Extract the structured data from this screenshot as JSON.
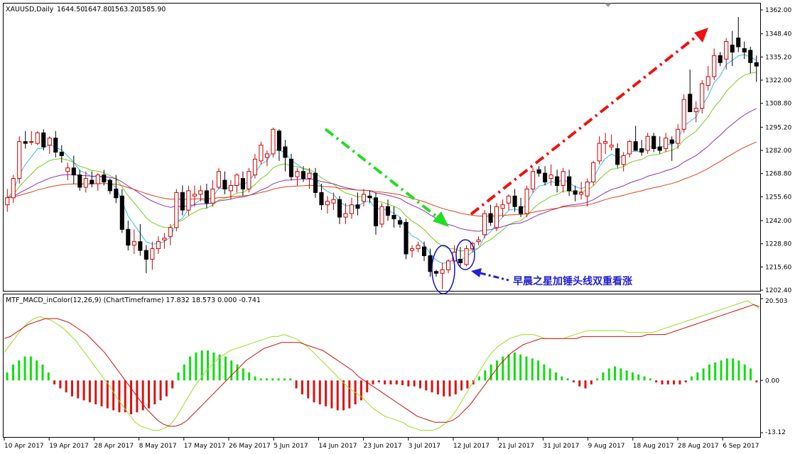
{
  "chart_data": [
    {
      "type": "candlestick",
      "title": "XAUUSD,Daily",
      "ohlc_summary": [
        "1644.50",
        "1647.80",
        "1563.20",
        "1585.90"
      ],
      "ylim": [
        1202.4,
        1362.0
      ],
      "y_ticks": [
        "1362.00",
        "1348.40",
        "1335.20",
        "1322.00",
        "1308.80",
        "1295.20",
        "1282.00",
        "1268.80",
        "1255.60",
        "1242.00",
        "1228.80",
        "1215.60",
        "1202.40"
      ],
      "x_ticks": [
        "10 Apr 2017",
        "19 Apr 2017",
        "28 Apr 2017",
        "8 May 2017",
        "17 May 2017",
        "26 May 2017",
        "5 Jun 2017",
        "14 Jun 2017",
        "23 Jun 2017",
        "3 Jul 2017",
        "12 Jul 2017",
        "21 Jul 2017",
        "31 Jul 2017",
        "9 Aug 2017",
        "18 Aug 2017",
        "28 Aug 2017",
        "6 Sep 2017"
      ],
      "colors": {
        "bull": "#cc0000",
        "bear": "#000000",
        "ma_fast": "#33bbee",
        "ma_mid": "#77cc22",
        "ma_slow": "#8833bb",
        "ma_long": "#dd4411"
      },
      "candles": [
        [
          1251,
          1260,
          1247,
          1255
        ],
        [
          1255,
          1268,
          1252,
          1266
        ],
        [
          1266,
          1290,
          1263,
          1287
        ],
        [
          1287,
          1293,
          1283,
          1286
        ],
        [
          1287,
          1293,
          1285,
          1287
        ],
        [
          1286,
          1293,
          1285,
          1292
        ],
        [
          1292,
          1294,
          1282,
          1284
        ],
        [
          1285,
          1290,
          1280,
          1289
        ],
        [
          1289,
          1293,
          1278,
          1281
        ],
        [
          1281,
          1285,
          1275,
          1279
        ],
        [
          1270,
          1275,
          1265,
          1272
        ],
        [
          1272,
          1279,
          1263,
          1268
        ],
        [
          1268,
          1271,
          1259,
          1261
        ],
        [
          1261,
          1270,
          1258,
          1266
        ],
        [
          1265,
          1270,
          1261,
          1263
        ],
        [
          1263,
          1269,
          1259,
          1268
        ],
        [
          1268,
          1271,
          1262,
          1264
        ],
        [
          1265,
          1266,
          1257,
          1259
        ],
        [
          1260,
          1268,
          1252,
          1255
        ],
        [
          1256,
          1260,
          1235,
          1237
        ],
        [
          1237,
          1242,
          1225,
          1228
        ],
        [
          1228,
          1237,
          1223,
          1230
        ],
        [
          1230,
          1240,
          1222,
          1225
        ],
        [
          1225,
          1228,
          1212,
          1220
        ],
        [
          1220,
          1230,
          1214,
          1226
        ],
        [
          1226,
          1233,
          1223,
          1230
        ],
        [
          1231,
          1235,
          1226,
          1232
        ],
        [
          1233,
          1240,
          1228,
          1238
        ],
        [
          1238,
          1260,
          1236,
          1258
        ],
        [
          1258,
          1262,
          1245,
          1248
        ],
        [
          1248,
          1262,
          1245,
          1259
        ],
        [
          1256,
          1262,
          1250,
          1257
        ],
        [
          1257,
          1262,
          1253,
          1259
        ],
        [
          1259,
          1263,
          1249,
          1252
        ],
        [
          1252,
          1265,
          1250,
          1260
        ],
        [
          1261,
          1272,
          1260,
          1270
        ],
        [
          1265,
          1270,
          1257,
          1260
        ],
        [
          1259,
          1265,
          1254,
          1262
        ],
        [
          1262,
          1269,
          1258,
          1268
        ],
        [
          1266,
          1270,
          1256,
          1260
        ],
        [
          1260,
          1272,
          1258,
          1270
        ],
        [
          1268,
          1280,
          1266,
          1277
        ],
        [
          1276,
          1287,
          1274,
          1285
        ],
        [
          1278,
          1282,
          1273,
          1280
        ],
        [
          1280,
          1295,
          1278,
          1294
        ],
        [
          1293,
          1294,
          1276,
          1282
        ],
        [
          1284,
          1288,
          1270,
          1278
        ],
        [
          1277,
          1280,
          1265,
          1267
        ],
        [
          1267,
          1272,
          1262,
          1270
        ],
        [
          1270,
          1273,
          1264,
          1266
        ],
        [
          1266,
          1272,
          1260,
          1269
        ],
        [
          1269,
          1272,
          1255,
          1258
        ],
        [
          1258,
          1263,
          1248,
          1251
        ],
        [
          1251,
          1256,
          1246,
          1253
        ],
        [
          1252,
          1258,
          1248,
          1254
        ],
        [
          1254,
          1256,
          1240,
          1244
        ],
        [
          1244,
          1252,
          1240,
          1246
        ],
        [
          1246,
          1255,
          1243,
          1251
        ],
        [
          1251,
          1258,
          1245,
          1249
        ],
        [
          1253,
          1260,
          1250,
          1257
        ],
        [
          1256,
          1259,
          1252,
          1255
        ],
        [
          1255,
          1258,
          1234,
          1239
        ],
        [
          1240,
          1252,
          1238,
          1250
        ],
        [
          1250,
          1254,
          1242,
          1245
        ],
        [
          1245,
          1250,
          1238,
          1243
        ],
        [
          1242,
          1244,
          1238,
          1240
        ],
        [
          1241,
          1243,
          1220,
          1223
        ],
        [
          1225,
          1228,
          1221,
          1226
        ],
        [
          1226,
          1230,
          1224,
          1228
        ],
        [
          1227,
          1230,
          1219,
          1222
        ],
        [
          1222,
          1226,
          1210,
          1213
        ],
        [
          1213,
          1214,
          1210,
          1212
        ],
        [
          1212,
          1218,
          1203,
          1214
        ],
        [
          1214,
          1220,
          1212,
          1219
        ],
        [
          1219,
          1228,
          1216,
          1224
        ],
        [
          1220,
          1227,
          1216,
          1218
        ],
        [
          1217,
          1228,
          1216,
          1226
        ],
        [
          1226,
          1230,
          1224,
          1229
        ],
        [
          1230,
          1233,
          1228,
          1231
        ],
        [
          1234,
          1248,
          1232,
          1246
        ],
        [
          1246,
          1251,
          1239,
          1241
        ],
        [
          1238,
          1252,
          1236,
          1250
        ],
        [
          1249,
          1254,
          1244,
          1251
        ],
        [
          1252,
          1257,
          1248,
          1256
        ],
        [
          1256,
          1260,
          1247,
          1250
        ],
        [
          1250,
          1255,
          1244,
          1246
        ],
        [
          1246,
          1262,
          1244,
          1260
        ],
        [
          1260,
          1272,
          1258,
          1270
        ],
        [
          1271,
          1273,
          1267,
          1269
        ],
        [
          1269,
          1273,
          1262,
          1264
        ],
        [
          1266,
          1274,
          1262,
          1268
        ],
        [
          1267,
          1271,
          1258,
          1262
        ],
        [
          1262,
          1272,
          1258,
          1270
        ],
        [
          1267,
          1271,
          1256,
          1259
        ],
        [
          1259,
          1262,
          1253,
          1257
        ],
        [
          1257,
          1264,
          1254,
          1258
        ],
        [
          1256,
          1266,
          1250,
          1264
        ],
        [
          1264,
          1276,
          1262,
          1275
        ],
        [
          1276,
          1290,
          1274,
          1286
        ],
        [
          1286,
          1292,
          1280,
          1287
        ],
        [
          1284,
          1291,
          1282,
          1285
        ],
        [
          1283,
          1286,
          1272,
          1274
        ],
        [
          1274,
          1281,
          1270,
          1279
        ],
        [
          1280,
          1288,
          1278,
          1287
        ],
        [
          1287,
          1296,
          1283,
          1282
        ],
        [
          1283,
          1288,
          1279,
          1281
        ],
        [
          1282,
          1292,
          1280,
          1290
        ],
        [
          1290,
          1292,
          1281,
          1283
        ],
        [
          1284,
          1290,
          1280,
          1282
        ],
        [
          1283,
          1292,
          1281,
          1289
        ],
        [
          1288,
          1290,
          1276,
          1286
        ],
        [
          1286,
          1297,
          1283,
          1294
        ],
        [
          1294,
          1314,
          1292,
          1311
        ],
        [
          1314,
          1328,
          1308,
          1304
        ],
        [
          1304,
          1310,
          1298,
          1306
        ],
        [
          1306,
          1322,
          1303,
          1320
        ],
        [
          1319,
          1330,
          1316,
          1324
        ],
        [
          1324,
          1340,
          1322,
          1336
        ],
        [
          1336,
          1338,
          1330,
          1332
        ],
        [
          1334,
          1346,
          1328,
          1344
        ],
        [
          1342,
          1350,
          1330,
          1338
        ],
        [
          1346,
          1358,
          1338,
          1341
        ],
        [
          1340,
          1344,
          1334,
          1338
        ],
        [
          1339,
          1341,
          1326,
          1332
        ],
        [
          1332,
          1336,
          1321,
          1330
        ]
      ],
      "annotation": "早晨之星加锤头线双重看涨"
    },
    {
      "type": "histogram",
      "title": "MTF_MACD_inColor(12,26,9) (ChartTimeframe) 17.832 18.573 0.000 -0.741",
      "ylim": [
        -13.12,
        20.503
      ],
      "y_ticks": [
        "20.503",
        "0.00",
        "-13.12"
      ],
      "colors": {
        "positive": "#11dd11",
        "negative": "#dd1111",
        "macd_line": "#99dd22",
        "signal_line": "#cc1111"
      },
      "histogram": [
        2,
        4,
        5,
        6,
        6,
        5,
        4,
        2,
        -1,
        -2,
        -3,
        -4,
        -4.5,
        -5,
        -5.5,
        -6,
        -6.5,
        -7,
        -7.5,
        -8,
        -8,
        -8.5,
        -8,
        -7.5,
        -7,
        -6,
        -5,
        -4,
        -2,
        2,
        4,
        6,
        7,
        7.5,
        7.5,
        7,
        6.5,
        6,
        5,
        4,
        3,
        2,
        1,
        0.5,
        0.5,
        0.5,
        0.5,
        0.5,
        0.5,
        -2,
        -3.5,
        -4.5,
        -5.5,
        -6,
        -6.5,
        -7,
        -7.5,
        -7.5,
        -7,
        -6,
        -5,
        -3,
        -1,
        -0.5,
        -1,
        -1,
        -1,
        -1.2,
        -1.5,
        -1.5,
        -2,
        -2.5,
        -3,
        -3.5,
        -4,
        -4,
        -3.5,
        -2.5,
        -2,
        -1,
        1,
        2.5,
        4,
        5,
        6,
        6.5,
        7,
        6.5,
        6,
        5.5,
        5,
        4,
        3,
        2,
        1,
        0.5,
        -0.5,
        -1.5,
        -2,
        -1,
        0.5,
        2,
        3,
        3.5,
        3,
        2.5,
        2,
        1.5,
        1,
        0.5,
        -0.5,
        -1,
        -1,
        -1,
        -1,
        -0.5,
        1,
        2,
        3,
        4,
        4.5,
        5,
        5.5,
        5.5,
        5,
        4,
        3,
        -0.5
      ],
      "macd_line": [
        7,
        9,
        11,
        13,
        14.5,
        15.5,
        16,
        15.5,
        15,
        14,
        13,
        11.5,
        10,
        8,
        6,
        4,
        2,
        0,
        -2,
        -4.5,
        -6.5,
        -8.5,
        -10.5,
        -11.5,
        -12,
        -12.5,
        -12.5,
        -12,
        -11,
        -9,
        -6.5,
        -4,
        -1.5,
        0.5,
        2.5,
        4,
        5.5,
        6.5,
        7.5,
        8,
        8.5,
        9,
        9.5,
        10,
        10.5,
        11,
        11,
        11.5,
        11,
        10.5,
        9.5,
        8.5,
        7,
        5.5,
        4,
        2.5,
        1,
        -0.5,
        -2,
        -3,
        -4,
        -5.5,
        -7,
        -8,
        -9,
        -9.5,
        -10,
        -10.5,
        -11.5,
        -12,
        -12.5,
        -12.5,
        -12.5,
        -12,
        -11,
        -9.5,
        -7.5,
        -5,
        -2.5,
        0,
        2.5,
        5,
        7,
        8.5,
        9.5,
        10.5,
        11,
        11.5,
        11.5,
        11.5,
        11,
        10.5,
        10.5,
        10.5,
        10.5,
        11,
        11.5,
        12,
        12.5,
        12.5,
        12.5,
        12.5,
        12.5,
        12.5,
        12.5,
        12,
        12,
        12,
        12,
        12,
        12.5,
        13,
        13.5,
        14,
        14.5,
        15,
        15.5,
        16,
        16.5,
        17,
        17.5,
        18,
        18.5,
        19,
        19.5,
        20,
        19,
        18
      ],
      "signal_line": [
        10.5,
        11,
        12,
        13,
        14,
        14.5,
        15,
        15.5,
        15.5,
        15.5,
        15,
        14.5,
        13.5,
        12.5,
        11.5,
        10,
        8.5,
        7,
        5,
        3,
        1,
        -1,
        -3,
        -5,
        -7,
        -8.5,
        -10,
        -11,
        -11.5,
        -11.5,
        -11,
        -10,
        -8.5,
        -7,
        -5.5,
        -4,
        -2.5,
        -1,
        0.5,
        2,
        3.5,
        5,
        6,
        7,
        8,
        8.5,
        9,
        9.5,
        9.5,
        9.5,
        9.5,
        9,
        8.5,
        8,
        7.5,
        6.5,
        5.5,
        4.5,
        3.5,
        2.5,
        1,
        0,
        -1,
        -2,
        -3,
        -4,
        -5,
        -6,
        -7,
        -8,
        -9,
        -9.5,
        -10,
        -10.5,
        -10.5,
        -10.5,
        -10,
        -9,
        -7.5,
        -6,
        -4,
        -2,
        0,
        2,
        4,
        5.5,
        7,
        8,
        9,
        9.5,
        10,
        10.5,
        10.5,
        10.5,
        10.5,
        10.5,
        10.5,
        10.5,
        11,
        11,
        11,
        11,
        11,
        11,
        11,
        11,
        11,
        11,
        11,
        11.5,
        11.5,
        11.5,
        11.5,
        12,
        12.5,
        13,
        13.5,
        14,
        14.5,
        15,
        15.5,
        16,
        16.5,
        17,
        17.5,
        18,
        18.5,
        19,
        18.5
      ]
    }
  ]
}
